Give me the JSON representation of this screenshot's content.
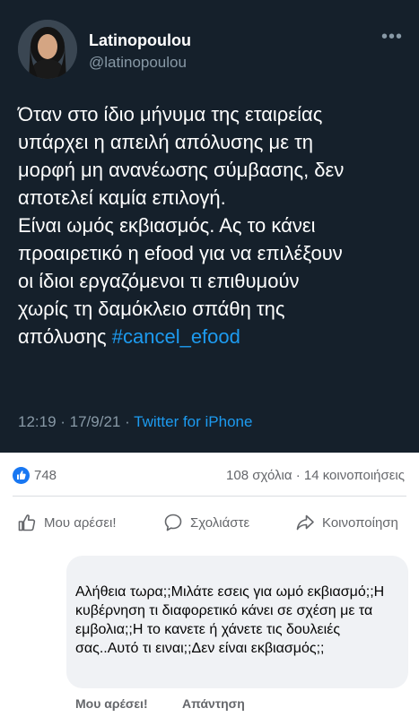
{
  "tweet": {
    "display_name": "Latinopoulou",
    "handle": "@latinopoulou",
    "more_icon": "more-icon",
    "text": "Όταν στο ίδιο μήνυμα της εταιρείας\nυπάρχει η απειλή απόλυσης με τη\nμορφή μη ανανέωσης σύμβασης, δεν\nαποτελεί καμία επιλογή.\nΕίναι ωμός εκβιασμός. Ας το κάνει\nπροαιρετικό η efood για να επιλέξουν\nοι ίδιοι εργαζόμενοι τι επιθυμούν\nχωρίς τη δαμόκλειο σπάθη της\nαπόλυσης ",
    "hashtag": "#cancel_efood",
    "timestamp": "12:19 · 17/9/21 · ",
    "source": "Twitter for iPhone",
    "colors": {
      "background": "#15202b",
      "accent": "#1d9bf0",
      "muted": "#8899a6"
    }
  },
  "post": {
    "like_count": "748",
    "comments_shares": "108 σχόλια · 14 κοινοποιήσεις",
    "actions": {
      "like": "Μου αρέσει!",
      "comment": "Σχολιάστε",
      "share": "Κοινοποίηση"
    },
    "colors": {
      "brand": "#1877f2",
      "muted": "#65676b"
    }
  },
  "comment": {
    "text": "Αλήθεια τωρα;;Μιλάτε εσεις για ωμό εκβιασμό;;Η κυβέρνηση τι διαφορετικό κάνει σε σχέση με τα εμβολια;;Η το κανετε ή χάνετε τις δουλειές σας..Αυτό τι ειναι;;Δεν είναι εκβιασμός;;",
    "like_label": "Μου αρέσει!",
    "reply_label": "Απάντηση"
  }
}
